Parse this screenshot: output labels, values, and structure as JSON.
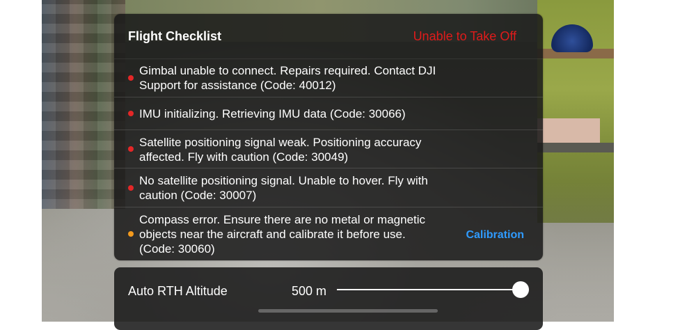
{
  "checklist": {
    "title": "Flight Checklist",
    "status": "Unable to Take Off",
    "status_color": "#e01b1b",
    "items": [
      {
        "severity": "error",
        "lines": [
          "Gimbal unable to connect. Repairs required. Contact DJI",
          "Support for assistance (Code: 40012)"
        ]
      },
      {
        "severity": "error",
        "lines": [
          "IMU initializing. Retrieving IMU data (Code: 30066)"
        ]
      },
      {
        "severity": "error",
        "lines": [
          "Satellite positioning signal weak. Positioning accuracy",
          "affected. Fly with caution (Code: 30049)"
        ]
      },
      {
        "severity": "error",
        "lines": [
          "No satellite positioning signal. Unable to hover. Fly with",
          "caution (Code: 30007)"
        ]
      },
      {
        "severity": "warning",
        "lines": [
          "Compass error. Ensure there are no metal or magnetic",
          "objects near the aircraft and calibrate it before use.",
          "(Code: 30060)"
        ],
        "action": "Calibration"
      }
    ],
    "action_color": "#2f9bff"
  },
  "rth": {
    "label": "Auto RTH Altitude",
    "value": "500 m",
    "slider_level": 1.0
  }
}
